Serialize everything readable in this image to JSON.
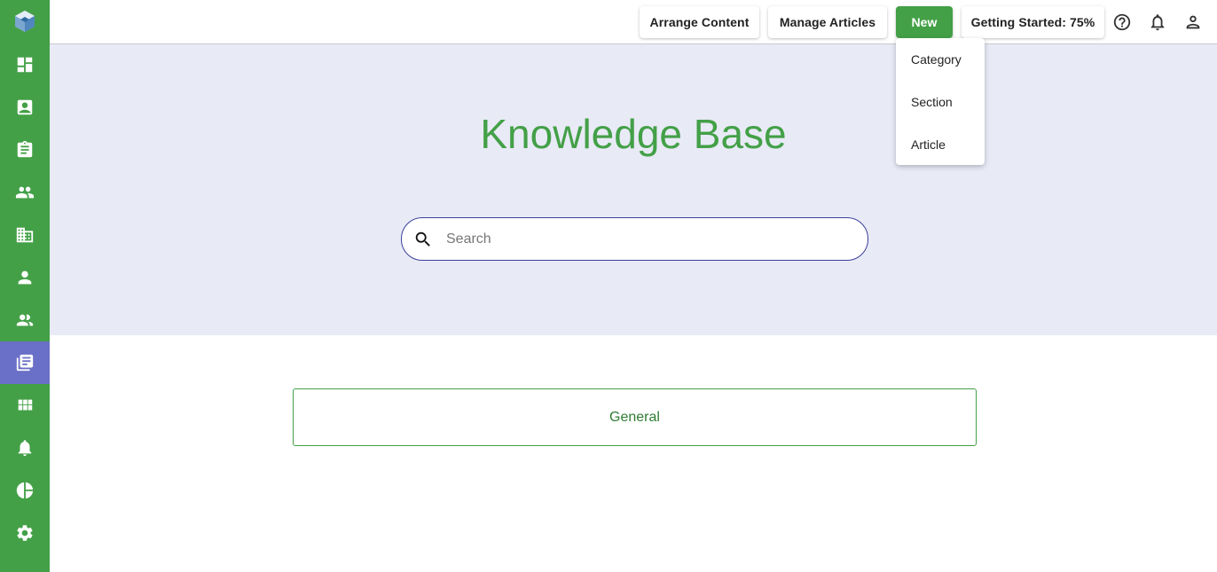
{
  "sidebar": {
    "items": [
      {
        "name": "dashboard-icon",
        "active": false
      },
      {
        "name": "contacts-icon",
        "active": false
      },
      {
        "name": "assignment-icon",
        "active": false
      },
      {
        "name": "people-icon",
        "active": false
      },
      {
        "name": "building-icon",
        "active": false
      },
      {
        "name": "person-icon",
        "active": false
      },
      {
        "name": "supervisor-icon",
        "active": false
      },
      {
        "name": "library-books-icon",
        "active": true
      },
      {
        "name": "apps-grid-icon",
        "active": false
      },
      {
        "name": "bell-icon",
        "active": false
      },
      {
        "name": "pie-chart-icon",
        "active": false
      },
      {
        "name": "settings-gear-icon",
        "active": false
      }
    ]
  },
  "topbar": {
    "arrange_label": "Arrange Content",
    "manage_label": "Manage Articles",
    "new_label": "New",
    "getting_started_label": "Getting Started: 75%",
    "icons": [
      "help-icon",
      "notifications-icon",
      "account-icon"
    ]
  },
  "new_menu": {
    "items": [
      "Category",
      "Section",
      "Article"
    ]
  },
  "hero": {
    "title": "Knowledge Base",
    "search_placeholder": "Search"
  },
  "categories": [
    "General"
  ],
  "colors": {
    "brand_green": "#43a047",
    "active_nav": "#6a6fc7",
    "hero_bg": "#e8eaf6",
    "search_border": "#3b3f9a"
  }
}
